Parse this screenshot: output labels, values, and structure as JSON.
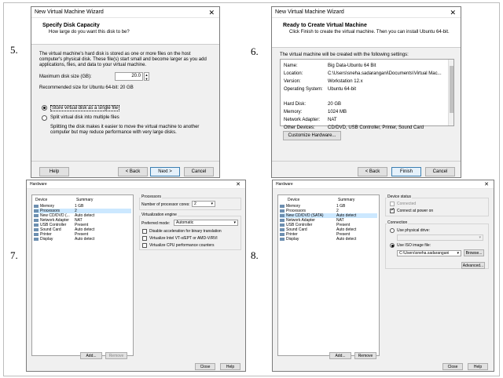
{
  "steps": [
    "5.",
    "6.",
    "7.",
    "8."
  ],
  "w5": {
    "title": "New Virtual Machine Wizard",
    "heading": "Specify Disk Capacity",
    "subheading": "How large do you want this disk to be?",
    "desc": "The virtual machine's hard disk is stored as one or more files on the host computer's physical disk. These file(s) start small and become larger as you add applications, files, and data to your virtual machine.",
    "max_label": "Maximum disk size (GB):",
    "max_value": "20.0",
    "recommended": "Recommended size for Ubuntu 64-bit: 20 GB",
    "opt_single": "Store virtual disk as a single file",
    "opt_multiple": "Split virtual disk into multiple files",
    "split_desc": "Splitting the disk makes it easier to move the virtual machine to another computer but may reduce performance with very large disks.",
    "help": "Help",
    "back": "< Back",
    "next": "Next >",
    "cancel": "Cancel"
  },
  "w6": {
    "title": "New Virtual Machine Wizard",
    "heading": "Ready to Create Virtual Machine",
    "subheading": "Click Finish to create the virtual machine. Then you can install Ubuntu 64-bit.",
    "intro": "The virtual machine will be created with the following settings:",
    "settings": [
      {
        "k": "Name:",
        "v": "Big Data-Ubuntu 64 Bit"
      },
      {
        "k": "Location:",
        "v": "C:\\Users\\sneha.sadarangani\\Documents\\Virtual Mac..."
      },
      {
        "k": "Version:",
        "v": "Workstation 12.x"
      },
      {
        "k": "Operating System:",
        "v": "Ubuntu 64-bit"
      },
      {
        "k": "Hard Disk:",
        "v": "20 GB"
      },
      {
        "k": "Memory:",
        "v": "1024 MB"
      },
      {
        "k": "Network Adapter:",
        "v": "NAT"
      },
      {
        "k": "Other Devices:",
        "v": "CD/DVD, USB Controller, Printer, Sound Card"
      }
    ],
    "customize": "Customize Hardware...",
    "back": "< Back",
    "finish": "Finish",
    "cancel": "Cancel"
  },
  "hw": {
    "title": "Hardware",
    "col_device": "Device",
    "col_summary": "Summary",
    "devices": [
      {
        "d": "Memory",
        "s": "1 GB"
      },
      {
        "d": "Processors",
        "s": "2"
      },
      {
        "d": "New CD/DVD (...",
        "s": "Auto detect"
      },
      {
        "d": "Network Adapter",
        "s": "NAT"
      },
      {
        "d": "USB Controller",
        "s": "Present"
      },
      {
        "d": "Sound Card",
        "s": "Auto detect"
      },
      {
        "d": "Printer",
        "s": "Present"
      },
      {
        "d": "Display",
        "s": "Auto detect"
      }
    ],
    "devices8_cd": "New CD/DVD (SATA)",
    "add": "Add...",
    "remove": "Remove",
    "close": "Close",
    "help": "Help"
  },
  "w7": {
    "processors_title": "Processors",
    "cores_label": "Number of processor cores:",
    "cores_value": "2",
    "virt_title": "Virtualization engine",
    "mode_label": "Preferred mode:",
    "mode_value": "Automatic",
    "opt1": "Disable acceleration for binary translation",
    "opt2": "Virtualize Intel VT-x/EPT or AMD-V/RVI",
    "opt3": "Virtualize CPU performance counters"
  },
  "w8": {
    "status_title": "Device status",
    "connected": "Connected",
    "power_on": "Connect at power on",
    "connection_title": "Connection",
    "use_physical": "Use physical drive:",
    "physical_value": "",
    "use_iso": "Use ISO image file:",
    "iso_value": "C:\\Users\\sneha.sadarangani",
    "browse": "Browse...",
    "advanced": "Advanced..."
  }
}
